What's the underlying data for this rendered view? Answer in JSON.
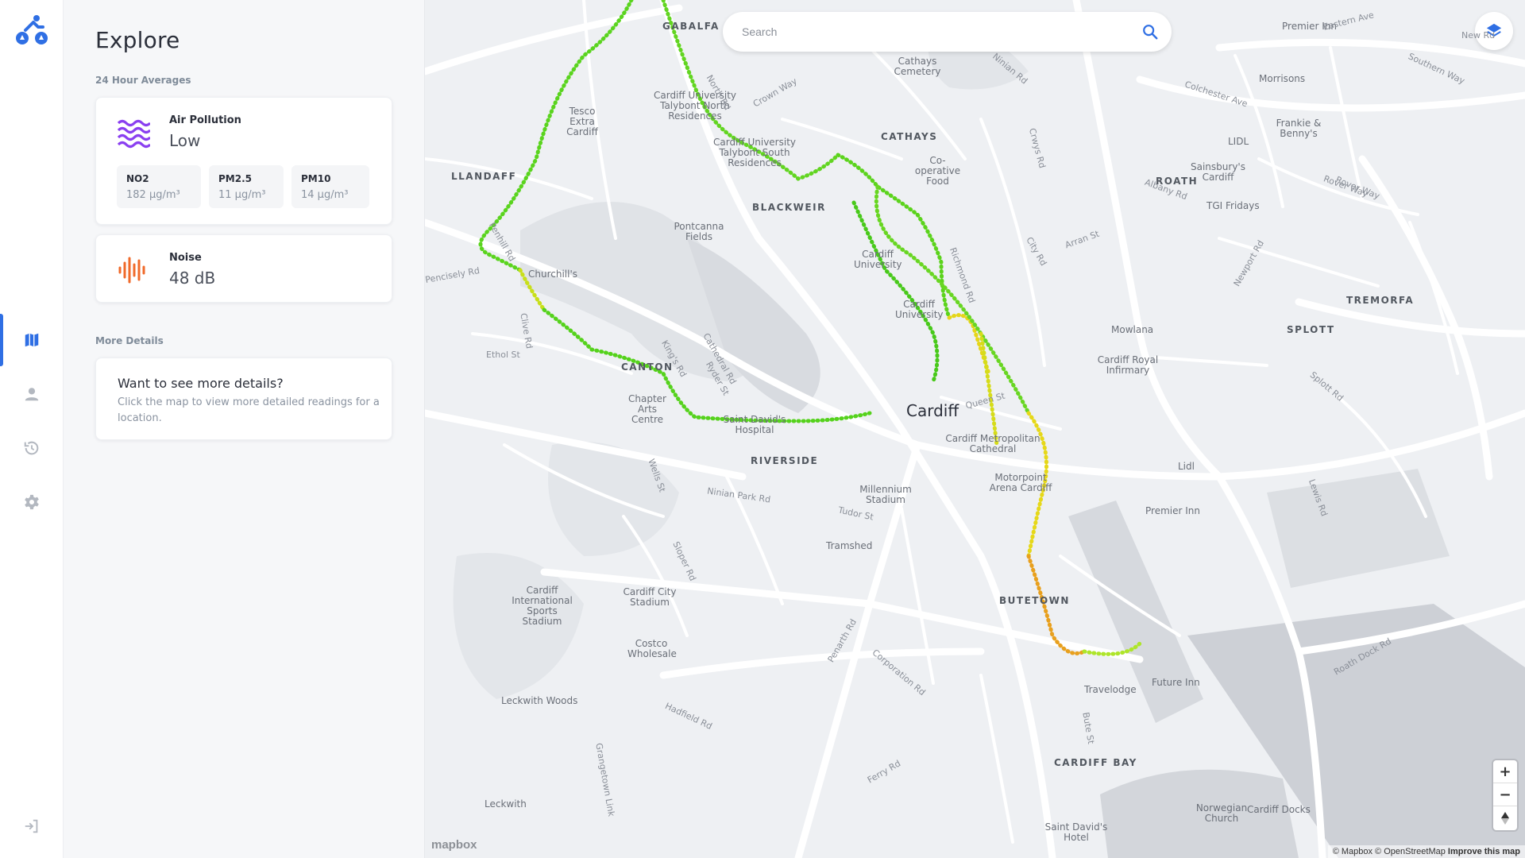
{
  "panel": {
    "title": "Explore",
    "averages_heading": "24 Hour Averages",
    "air": {
      "title": "Air Pollution",
      "level": "Low"
    },
    "pollutants": [
      {
        "name": "NO2",
        "value": "182 μg/m³"
      },
      {
        "name": "PM2.5",
        "value": "11 μg/m³"
      },
      {
        "name": "PM10",
        "value": "14 μg/m³"
      }
    ],
    "noise": {
      "title": "Noise",
      "value": "48 dB"
    },
    "more_heading": "More Details",
    "more": {
      "title": "Want to see more details?",
      "text": "Click the map to view more detailed readings for a location."
    }
  },
  "search": {
    "placeholder": "Search"
  },
  "map": {
    "city": "Cardiff",
    "districts": [
      "GABALFA",
      "LLANDAFF",
      "CATHAYS",
      "BLACKWEIR",
      "ROATH",
      "TREMORFA",
      "SPLOTT",
      "CANTON",
      "RIVERSIDE",
      "BUTETOWN",
      "CARDIFF BAY"
    ],
    "places": [
      "Tesco Extra Cardiff",
      "Cardiff University Talybont North Residences",
      "Cardiff University Talybont South Residences",
      "Cathays Cemetery",
      "Co-operative Food",
      "Pontcanna Fields",
      "Cardiff University",
      "Cardiff University",
      "Churchill's",
      "Chapter Arts Centre",
      "Saint David's Hospital",
      "Cardiff Metropolitan Cathedral",
      "Motorpoint Arena Cardiff",
      "Millennium Stadium",
      "Tramshed",
      "Cardiff Royal Infirmary",
      "Mowlana",
      "Lidl",
      "Premier Inn",
      "Morrisons",
      "Frankie & Benny's",
      "LIDL",
      "Sainsbury's Cardiff",
      "TGI Fridays",
      "Premier Inn",
      "Cardiff International Sports Stadium",
      "Cardiff City Stadium",
      "Costco Wholesale",
      "Leckwith Woods",
      "Leckwith",
      "Travelodge",
      "Future Inn",
      "Norwegian Church",
      "Saint David's Hotel",
      "Cardiff Docks"
    ],
    "roads": [
      "Eastern Ave",
      "Colchester Ave",
      "Southern Way",
      "New Rd",
      "Crown Way",
      "North Rd",
      "Ninian Rd",
      "Albany Rd",
      "Rover Way",
      "Newport Rd",
      "Queen St",
      "Tudor St",
      "Ninian Park Rd",
      "Sloper Rd",
      "Penarth Rd",
      "Corporation Rd",
      "Ferry Rd",
      "Hadfield Rd",
      "Grangetown Link",
      "Rover Way",
      "Lewis Rd",
      "Roath Dock Rd",
      "Bute St",
      "Cathedral Rd",
      "Ryder St",
      "Wells St",
      "King's Rd",
      "Clive Rd",
      "Ethol St",
      "Penhill Rd",
      "Pencisely Rd",
      "Splott Rd",
      "Richmond Rd",
      "City Rd",
      "Crwys Rd",
      "Arran St"
    ],
    "attribution": "© Mapbox © OpenStreetMap",
    "improve": "Improve this map",
    "logo": "mapbox"
  },
  "colors": {
    "accent": "#2f6fe4",
    "air_icon": "#8a3ff0",
    "noise_icon": "#f06a2a"
  }
}
